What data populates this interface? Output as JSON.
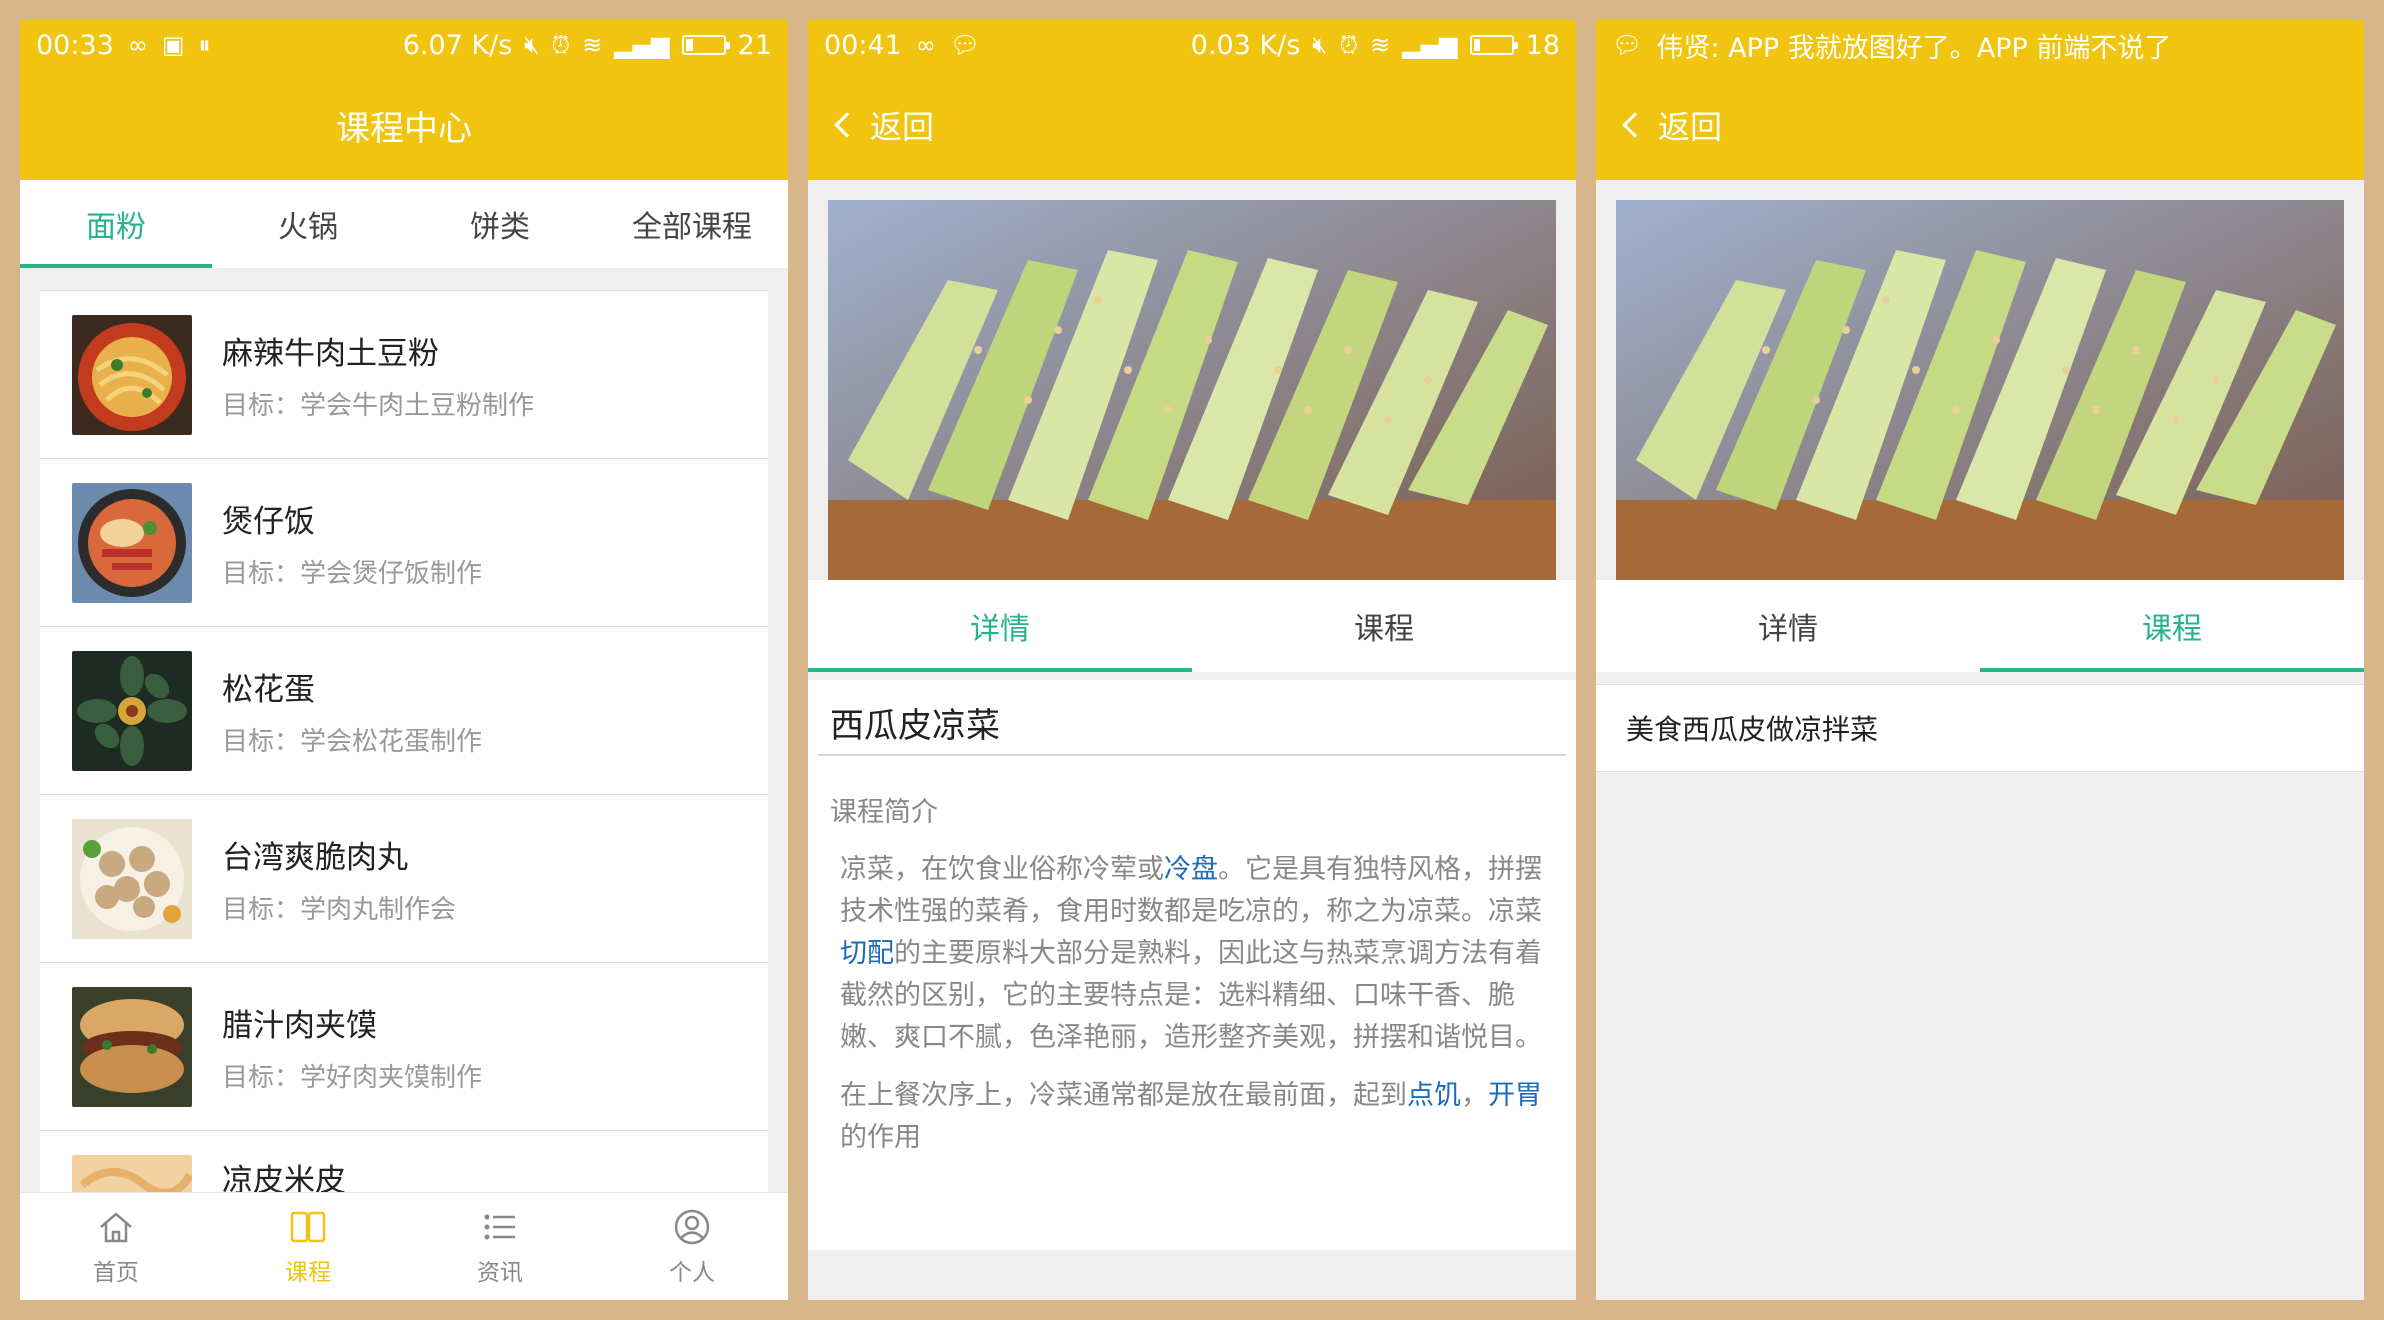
{
  "panel1": {
    "status": {
      "time": "00:33",
      "speed": "6.07 K/s",
      "battery": "21",
      "battery_fraction": 0.21
    },
    "title": "课程中心",
    "tabs": [
      {
        "label": "面粉",
        "active": true
      },
      {
        "label": "火锅",
        "active": false
      },
      {
        "label": "饼类",
        "active": false
      },
      {
        "label": "全部课程",
        "active": false
      }
    ],
    "courses": [
      {
        "title": "麻辣牛肉土豆粉",
        "goal": "目标：学会牛肉土豆粉制作"
      },
      {
        "title": "煲仔饭",
        "goal": "目标：学会煲仔饭制作"
      },
      {
        "title": "松花蛋",
        "goal": "目标：学会松花蛋制作"
      },
      {
        "title": "台湾爽脆肉丸",
        "goal": "目标：学肉丸制作会"
      },
      {
        "title": "腊汁肉夹馍",
        "goal": "目标：学好肉夹馍制作"
      },
      {
        "title": "凉皮米皮",
        "goal": ""
      }
    ],
    "nav": [
      {
        "label": "首页",
        "icon": "home-icon",
        "active": false
      },
      {
        "label": "课程",
        "icon": "book-icon",
        "active": true
      },
      {
        "label": "资讯",
        "icon": "list-icon",
        "active": false
      },
      {
        "label": "个人",
        "icon": "user-icon",
        "active": false
      }
    ]
  },
  "panel2": {
    "status": {
      "time": "00:41",
      "speed": "0.03 K/s",
      "battery": "18",
      "battery_fraction": 0.18
    },
    "back_label": "返回",
    "tabs": [
      {
        "label": "详情",
        "active": true
      },
      {
        "label": "课程",
        "active": false
      }
    ],
    "title": "西瓜皮凉菜",
    "intro_heading": "课程简介",
    "para1": {
      "a": "凉菜，在饮食业俗称冷荤或",
      "link1": "冷盘",
      "b": "。它是具有独特风格，拼摆技术性强的菜肴，食用时数都是吃凉的，称之为凉菜。凉菜",
      "link2": "切配",
      "c": "的主要原料大部分是熟料，因此这与热菜烹调方法有着截然的区别，它的主要特点是：选料精细、口味干香、脆嫩、爽口不腻，色泽艳丽，造形整齐美观，拼摆和谐悦目。"
    },
    "para2": {
      "a": "在上餐次序上，冷菜通常都是放在最前面，起到",
      "link1": "点饥",
      "b": "，",
      "link2": "开胃",
      "c": "的作用"
    }
  },
  "panel3": {
    "notification": "伟贤: APP 我就放图好了。APP 前端不说了",
    "back_label": "返回",
    "tabs": [
      {
        "label": "详情",
        "active": false
      },
      {
        "label": "课程",
        "active": true
      }
    ],
    "course_item": "美食西瓜皮做凉拌菜"
  },
  "colors": {
    "brand_yellow": "#f1c40f",
    "accent_green": "#27b38d",
    "link_blue": "#1e6bb8"
  }
}
